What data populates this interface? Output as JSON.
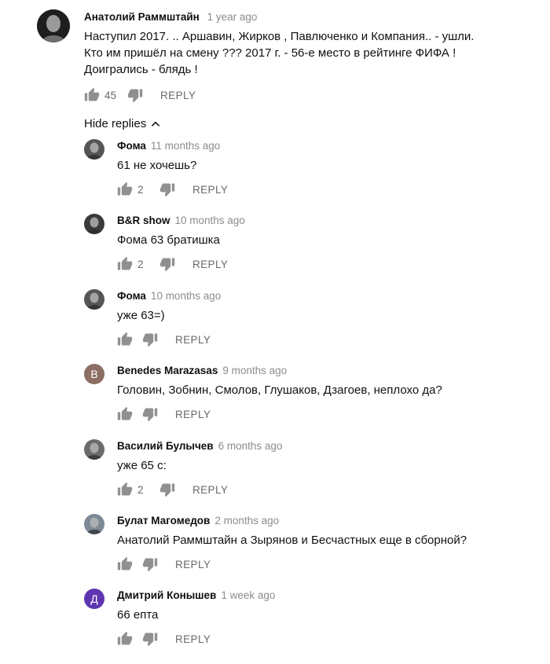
{
  "main_comment": {
    "author": "Анатолий Раммштайн",
    "time": "1 year ago",
    "lines": [
      "Наступил 2017. .. Аршавин, Жирков , Павлюченко и Компания.. - ушли.",
      "Кто им пришёл на смену ???  2017 г. -  56-е место в рейтинге ФИФА !",
      "Доигрались -  блядь !"
    ],
    "likes": "45",
    "reply_label": "REPLY",
    "avatar_color": "#2c2c2c"
  },
  "hide_replies_label": "Hide replies",
  "replies": [
    {
      "author": "Фома",
      "time": "11 months ago",
      "text": "61 не хочешь?",
      "likes": "2",
      "reply_label": "REPLY",
      "avatar_letter": "",
      "avatar_color": "#555555"
    },
    {
      "author": "B&R show",
      "time": "10 months ago",
      "text": "Фома 63 братишка",
      "likes": "2",
      "reply_label": "REPLY",
      "avatar_letter": "",
      "avatar_color": "#3a3a3a"
    },
    {
      "author": "Фома",
      "time": "10 months ago",
      "text": "уже 63=)",
      "likes": "",
      "reply_label": "REPLY",
      "avatar_letter": "",
      "avatar_color": "#555555"
    },
    {
      "author": "Benedes Marazasas",
      "time": "9 months ago",
      "text": "Головин, Зобнин,  Смолов, Глушаков, Дзагоев, неплохо да?",
      "likes": "",
      "reply_label": "REPLY",
      "avatar_letter": "B",
      "avatar_color": "#8d6e63"
    },
    {
      "author": "Василий Булычев",
      "time": "6 months ago",
      "text": "уже 65  с:",
      "likes": "2",
      "reply_label": "REPLY",
      "avatar_letter": "",
      "avatar_color": "#6b6b6b"
    },
    {
      "author": "Булат Магомедов",
      "time": "2 months ago",
      "text": "Анатолий Раммштайн а Зырянов и Бесчастных еще в сборной?",
      "likes": "",
      "reply_label": "REPLY",
      "avatar_letter": "",
      "avatar_color": "#7d8a96"
    },
    {
      "author": "Дмитрий Конышев",
      "time": "1 week ago",
      "text": "66 епта",
      "likes": "",
      "reply_label": "REPLY",
      "avatar_letter": "Д",
      "avatar_color": "#5e35b1"
    }
  ]
}
